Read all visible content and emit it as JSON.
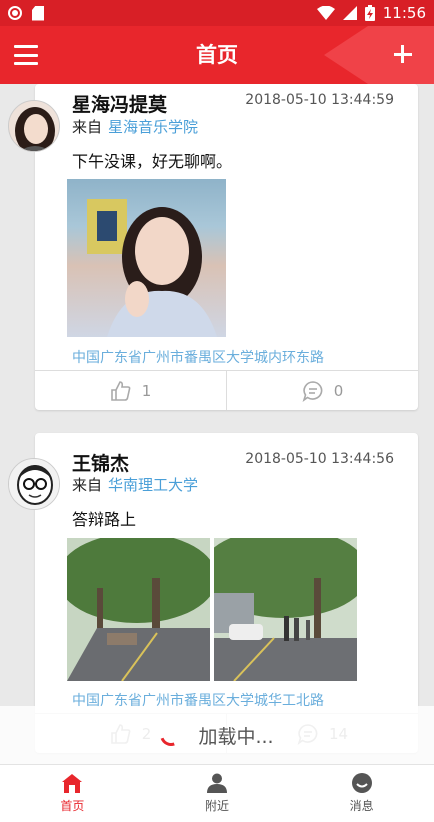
{
  "status_bar": {
    "time": "11:56",
    "icons": [
      "record-icon",
      "sd-card-icon",
      "wifi-icon",
      "signal-icon",
      "battery-charging-icon"
    ]
  },
  "app_bar": {
    "title": "首页",
    "menu_icon": "menu-icon",
    "add_icon": "plus-icon"
  },
  "posts": [
    {
      "author": "星海冯提莫",
      "time": "2018-05-10 13:44:59",
      "from_label": "来自",
      "school": "星海音乐学院",
      "text": "下午没课，好无聊啊。",
      "location": "中国广东省广州市番禺区大学城内环东路",
      "likes": "1",
      "comments": "0"
    },
    {
      "author": "王锦杰",
      "time": "2018-05-10 13:44:56",
      "from_label": "来自",
      "school": "华南理工大学",
      "text": "答辩路上",
      "location": "中国广东省广州市番禺区大学城华工北路",
      "likes": "2",
      "comments": "14"
    }
  ],
  "loading_text": "加载中...",
  "bottom_nav": [
    {
      "label": "首页",
      "icon": "home-icon",
      "active": true
    },
    {
      "label": "附近",
      "icon": "person-icon",
      "active": false
    },
    {
      "label": "消息",
      "icon": "message-icon",
      "active": false
    }
  ],
  "colors": {
    "primary_red": "#e8262c",
    "status_red": "#d81f26",
    "link_blue": "#4a9fd8",
    "location_blue": "#6aaedc"
  }
}
